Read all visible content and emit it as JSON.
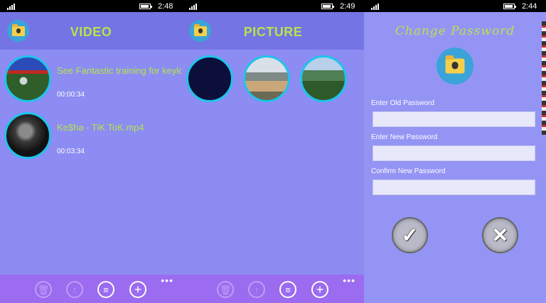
{
  "screen1": {
    "status_time": "2:48",
    "title": "VIDEO",
    "videos": [
      {
        "title": "See Fantastic training for keylo",
        "duration": "00:00:34"
      },
      {
        "title": "Ke$ha - TiK ToK.mp4",
        "duration": "00:03:34"
      }
    ],
    "more": "•••"
  },
  "screen2": {
    "status_time": "2:49",
    "title": "PICTURE",
    "more": "•••"
  },
  "screen3": {
    "status_time": "2:44",
    "title": "Change Password",
    "old_label": "Enter Old Password",
    "new_label": "Enter New Password",
    "confirm_label": "Confirm New Password"
  },
  "icons": {
    "delete": "🗑",
    "upload": "↑",
    "list": "≡",
    "add": "+",
    "ok": "✓",
    "cancel": "✕"
  },
  "colors": {
    "accent_green": "#b7e34a",
    "cyan_border": "#1fc3ec",
    "app_bg": "#8c8cf2",
    "bottom_bar": "#9b6bf0"
  }
}
